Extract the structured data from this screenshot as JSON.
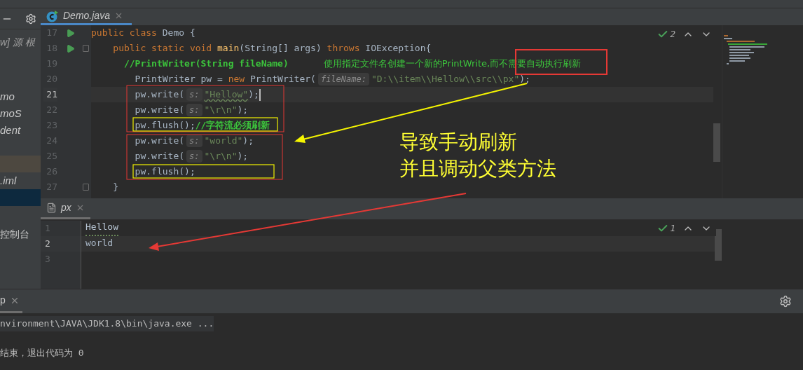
{
  "sidebar": {
    "path_label": "w] 源 根",
    "items": [
      {
        "label": "mo",
        "selected": false,
        "highlighted": false
      },
      {
        "label": "moS",
        "selected": false,
        "highlighted": false
      },
      {
        "label": "dent",
        "selected": false,
        "highlighted": false
      },
      {
        "selected": false,
        "highlighted": true
      },
      {
        "label": ".iml",
        "selected": false,
        "highlighted": false
      },
      {
        "selected": true,
        "highlighted": false
      }
    ],
    "console_label": "控制台"
  },
  "editor": {
    "tab": {
      "label": "Demo.java",
      "selected": true
    },
    "inspection": {
      "count": "2"
    },
    "lines": [
      {
        "number": "17",
        "run": true,
        "fold": false,
        "current": false,
        "caret": false,
        "tokens": [
          {
            "kind": "keyword",
            "text": "public class "
          },
          {
            "kind": "plain",
            "text": "Demo {"
          }
        ]
      },
      {
        "number": "18",
        "run": true,
        "fold": true,
        "current": false,
        "caret": false,
        "tokens": [
          {
            "kind": "keyword",
            "text": "    public static void "
          },
          {
            "kind": "method",
            "text": "main"
          },
          {
            "kind": "plain",
            "text": "(String[] args) "
          },
          {
            "kind": "keyword",
            "text": "throws "
          },
          {
            "kind": "plain",
            "text": "IOException{"
          }
        ]
      },
      {
        "number": "19",
        "run": false,
        "fold": false,
        "current": false,
        "caret": false,
        "tokens": [
          {
            "kind": "comment",
            "text": "      //PrintWriter(String fileName)"
          },
          {
            "kind": "note",
            "text": "使用指定文件名创建一个新的PrintWrite,而不需要自动执行刷新"
          }
        ]
      },
      {
        "number": "20",
        "run": false,
        "fold": false,
        "current": false,
        "caret": false,
        "tokens": [
          {
            "kind": "plain",
            "text": "        PrintWriter pw = "
          },
          {
            "kind": "keyword",
            "text": "new "
          },
          {
            "kind": "plain",
            "text": "PrintWriter("
          },
          {
            "kind": "hint",
            "text": "fileName:"
          },
          {
            "kind": "string",
            "text": "\"D:\\\\item\\\\Hellow\\\\src\\\\px\""
          },
          {
            "kind": "plain",
            "text": ");"
          }
        ]
      },
      {
        "number": "21",
        "run": false,
        "fold": false,
        "current": true,
        "caret": true,
        "tokens": [
          {
            "kind": "plain",
            "text": "        pw.write("
          },
          {
            "kind": "hint",
            "text": "s:"
          },
          {
            "kind": "typo",
            "text": "\"Hellow\""
          },
          {
            "kind": "plain",
            "text": ");"
          }
        ]
      },
      {
        "number": "22",
        "run": false,
        "fold": false,
        "current": false,
        "caret": false,
        "tokens": [
          {
            "kind": "plain",
            "text": "        pw.write("
          },
          {
            "kind": "hint",
            "text": "s:"
          },
          {
            "kind": "string",
            "text": "\"\\r\\n\""
          },
          {
            "kind": "plain",
            "text": ");"
          }
        ]
      },
      {
        "number": "23",
        "run": false,
        "fold": false,
        "current": false,
        "caret": false,
        "tokens": [
          {
            "kind": "plain",
            "text": "        pw.flush();"
          },
          {
            "kind": "comment",
            "text": "//字符流必须刷新"
          }
        ]
      },
      {
        "number": "24",
        "run": false,
        "fold": false,
        "current": false,
        "caret": false,
        "tokens": [
          {
            "kind": "plain",
            "text": "        pw.write("
          },
          {
            "kind": "hint",
            "text": "s:"
          },
          {
            "kind": "string",
            "text": "\"world\""
          },
          {
            "kind": "plain",
            "text": ");"
          }
        ]
      },
      {
        "number": "25",
        "run": false,
        "fold": false,
        "current": false,
        "caret": false,
        "tokens": [
          {
            "kind": "plain",
            "text": "        pw.write("
          },
          {
            "kind": "hint",
            "text": "s:"
          },
          {
            "kind": "string",
            "text": "\"\\r\\n\""
          },
          {
            "kind": "plain",
            "text": ");"
          }
        ]
      },
      {
        "number": "26",
        "run": false,
        "fold": false,
        "current": false,
        "caret": false,
        "tokens": [
          {
            "kind": "plain",
            "text": "        pw.flush();"
          }
        ]
      },
      {
        "number": "27",
        "run": false,
        "fold": true,
        "current": false,
        "caret": false,
        "tokens": [
          {
            "kind": "plain",
            "text": "    }"
          }
        ]
      }
    ]
  },
  "output_file": {
    "tab": {
      "label": "px",
      "selected": true
    },
    "inspection": {
      "count": "1"
    },
    "lines": [
      {
        "number": "1",
        "text": "Hellow",
        "typo": true,
        "current": false
      },
      {
        "number": "2",
        "text": "world",
        "typo": false,
        "current": true
      },
      {
        "number": "3",
        "current": false
      }
    ]
  },
  "run_panel": {
    "tab": {
      "label": "p",
      "selected": true
    },
    "lines": [
      {
        "text": "nvironment\\JAVA\\JDK1.8\\bin\\java.exe ...",
        "kind": "command"
      },
      {
        "text": "结束，退出代码为 0",
        "kind": "exit"
      }
    ]
  },
  "annotation": {
    "lines": [
      "导致手动刷新",
      "并且调动父类方法"
    ]
  }
}
